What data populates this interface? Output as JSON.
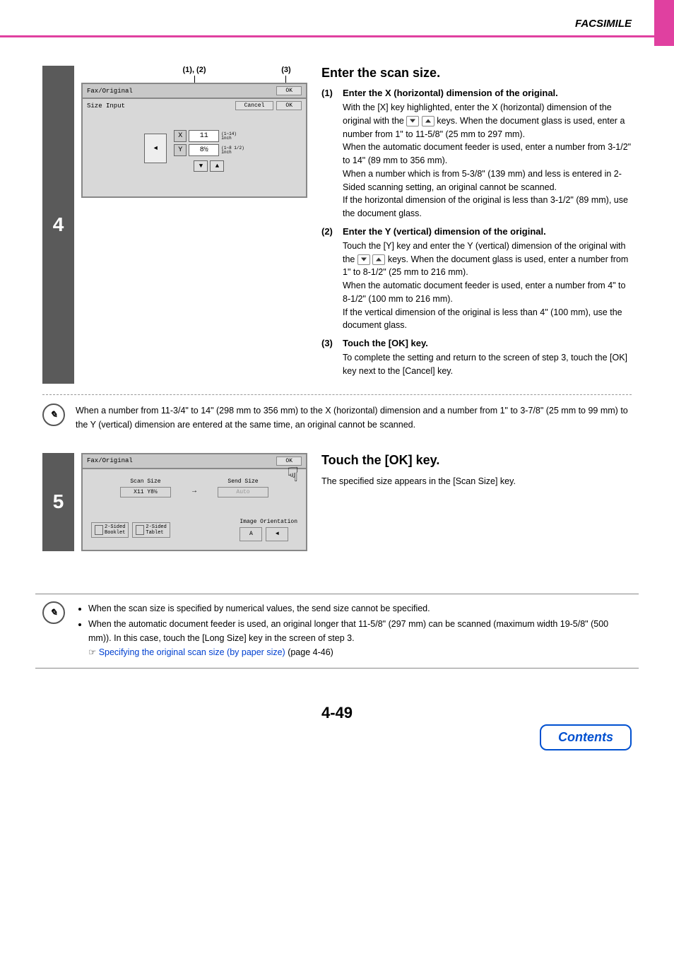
{
  "header": "FACSIMILE",
  "callouts": {
    "c12": "(1), (2)",
    "c3": "(3)"
  },
  "step4": {
    "num": "4",
    "title": "Enter the scan size.",
    "screen": {
      "header": "Fax/Original",
      "headerOk": "OK",
      "subheader": "Size Input",
      "cancel": "Cancel",
      "ok": "OK",
      "xLabel": "X",
      "xVal": "11",
      "xRange": "(1~14)\ninch",
      "yLabel": "Y",
      "yVal": "8½",
      "yRange": "(1~8 1/2)\ninch"
    },
    "sub1": {
      "num": "(1)",
      "title": "Enter the X (horizontal) dimension of the original.",
      "p1a": "With the [X] key highlighted, enter the X (horizontal) dimension of the original with the ",
      "p1b": " keys. When the document glass is used, enter a number from 1\" to 11-5/8\" (25 mm to 297 mm).",
      "p2": "When the automatic document feeder is used, enter a number from  3-1/2\" to 14\" (89 mm to 356 mm).",
      "p3": "When a number which is from 5-3/8\" (139 mm) and less is entered in 2-Sided scanning setting, an original cannot be scanned.",
      "p4": "If the horizontal dimension of the original is less than 3-1/2\" (89 mm), use the document glass."
    },
    "sub2": {
      "num": "(2)",
      "title": "Enter the Y (vertical) dimension of the original.",
      "p1a": "Touch the [Y] key and enter the Y (vertical) dimension of the original with the ",
      "p1b": " keys. When the document glass is used, enter a number from 1\" to 8-1/2\" (25 mm to 216 mm).",
      "p2": "When the automatic document feeder is used, enter a number from 4\" to 8-1/2\" (100 mm to 216 mm).",
      "p3": "If the vertical dimension of the original is less than 4\" (100 mm), use the document glass."
    },
    "sub3": {
      "num": "(3)",
      "title": "Touch the [OK] key.",
      "p1": "To complete the setting and return to the screen of step 3, touch the [OK] key next to the [Cancel] key."
    }
  },
  "note1": "When a number from 11-3/4\" to 14\" (298 mm to 356 mm) to the X (horizontal) dimension and a number from 1\" to 3-7/8\" (25 mm to 99 mm) to the Y (vertical) dimension are entered at the same time, an original cannot be scanned.",
  "step5": {
    "num": "5",
    "title": "Touch the [OK] key.",
    "text": "The specified size appears in the [Scan Size] key.",
    "screen": {
      "header": "Fax/Original",
      "ok": "OK",
      "scanSizeLabel": "Scan Size",
      "scanSizeVal": "X11 Y8½",
      "sendSizeLabel": "Send Size",
      "sendSizeVal": "Auto",
      "booklet": "2-Sided\nBooklet",
      "tablet": "2-Sided\nTablet",
      "orientLabel": "Image Orientation"
    }
  },
  "note2": {
    "b1": "When the scan size is specified by numerical values, the send size cannot be specified.",
    "b2a": "When the automatic document feeder is used, an original longer that 11-5/8\" (297 mm) can be scanned (maximum width 19-5/8\" (500 mm)). In this case, touch the [Long Size] key in the screen of step 3.",
    "b2link": "Specifying the original scan size (by paper size)",
    "b2page": " (page 4-46)"
  },
  "pageNum": "4-49",
  "contents": "Contents"
}
